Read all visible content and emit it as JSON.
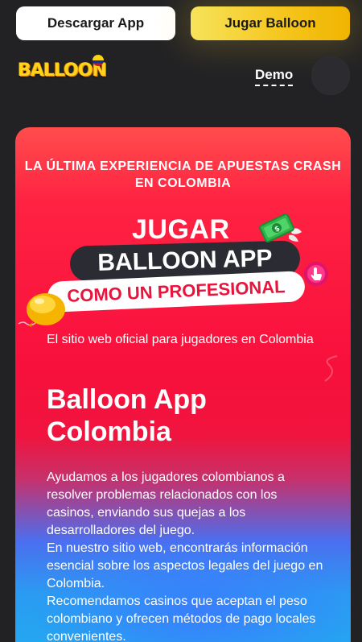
{
  "header": {
    "download_label": "Descargar App",
    "play_label": "Jugar Balloon",
    "logo_text": "BALLOON",
    "demo_label": "Demo"
  },
  "hero": {
    "heading": "LA ÚLTIMA EXPERIENCIA DE APUESTAS CRASH EN COLOMBIA",
    "art": {
      "line1": "JUGAR",
      "line2": "BALLOON APP",
      "line3": "COMO UN PROFESIONAL"
    },
    "tagline": "El sitio web oficial para jugadores en Colombia",
    "title": "Balloon App Colombia",
    "paragraphs": [
      "Ayudamos a los jugadores colombianos a resolver problemas relacionados con los casinos, enviando sus quejas a los desarrolladores del juego.",
      "En nuestro sitio web, encontrarás información esencial sobre los aspectos legales del juego en Colombia.",
      "Recomendamos casinos que aceptan el peso colombiano y ofrecen métodos de pago locales convenientes."
    ]
  },
  "colors": {
    "brand_yellow": "#f5c51c",
    "hero_red": "#f8103c",
    "hero_blue": "#22aaf0",
    "page_bg": "#222225"
  },
  "icons": [
    "colombia-flag-icon",
    "money-icon",
    "tap-hand-icon",
    "balloon-icon"
  ]
}
